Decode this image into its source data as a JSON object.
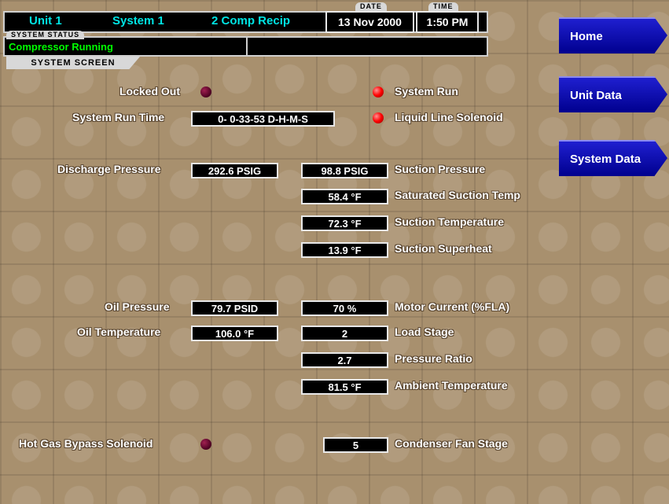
{
  "header": {
    "unit": "Unit 1",
    "system": "System 1",
    "type": "2 Comp Recip",
    "date_tag": "DATE",
    "date": "13 Nov 2000",
    "time_tag": "TIME",
    "time": "1:50 PM"
  },
  "status": {
    "tag": "SYSTEM STATUS",
    "text": "Compressor Running",
    "secondary": ""
  },
  "screen_title": "SYSTEM SCREEN",
  "nav": {
    "home": "Home",
    "unit_data": "Unit Data",
    "system_data": "System Data"
  },
  "indicators": {
    "locked_out": {
      "label": "Locked Out",
      "state": "off"
    },
    "system_run": {
      "label": "System Run",
      "state": "on"
    },
    "liquid_line_solenoid": {
      "label": "Liquid Line Solenoid",
      "state": "on"
    },
    "hot_gas_bypass": {
      "label": "Hot Gas Bypass Solenoid",
      "state": "off"
    }
  },
  "readings": {
    "system_run_time": {
      "label": "System Run Time",
      "value": "0- 0-33-53 D-H-M-S"
    },
    "discharge_pressure": {
      "label": "Discharge Pressure",
      "value": "292.6 PSIG"
    },
    "suction_pressure": {
      "label": "Suction Pressure",
      "value": "98.8 PSIG"
    },
    "saturated_suction_temp": {
      "label": "Saturated Suction Temp",
      "value": "58.4 °F"
    },
    "suction_temperature": {
      "label": "Suction Temperature",
      "value": "72.3 °F"
    },
    "suction_superheat": {
      "label": "Suction Superheat",
      "value": "13.9 °F"
    },
    "oil_pressure": {
      "label": "Oil Pressure",
      "value": "79.7 PSID"
    },
    "motor_current": {
      "label": "Motor Current (%FLA)",
      "value": "70 %"
    },
    "oil_temperature": {
      "label": "Oil Temperature",
      "value": "106.0 °F"
    },
    "load_stage": {
      "label": "Load Stage",
      "value": "2"
    },
    "pressure_ratio": {
      "label": "Pressure Ratio",
      "value": "2.7"
    },
    "ambient_temperature": {
      "label": "Ambient Temperature",
      "value": "81.5 °F"
    },
    "condenser_fan_stage": {
      "label": "Condenser Fan Stage",
      "value": "5"
    }
  },
  "colors": {
    "background": "#a8906e",
    "header_text": "#00e4e4",
    "status_text": "#00ff00",
    "nav_button": "#1010b8",
    "led_on": "#ff0000",
    "led_off": "#6a0030"
  }
}
